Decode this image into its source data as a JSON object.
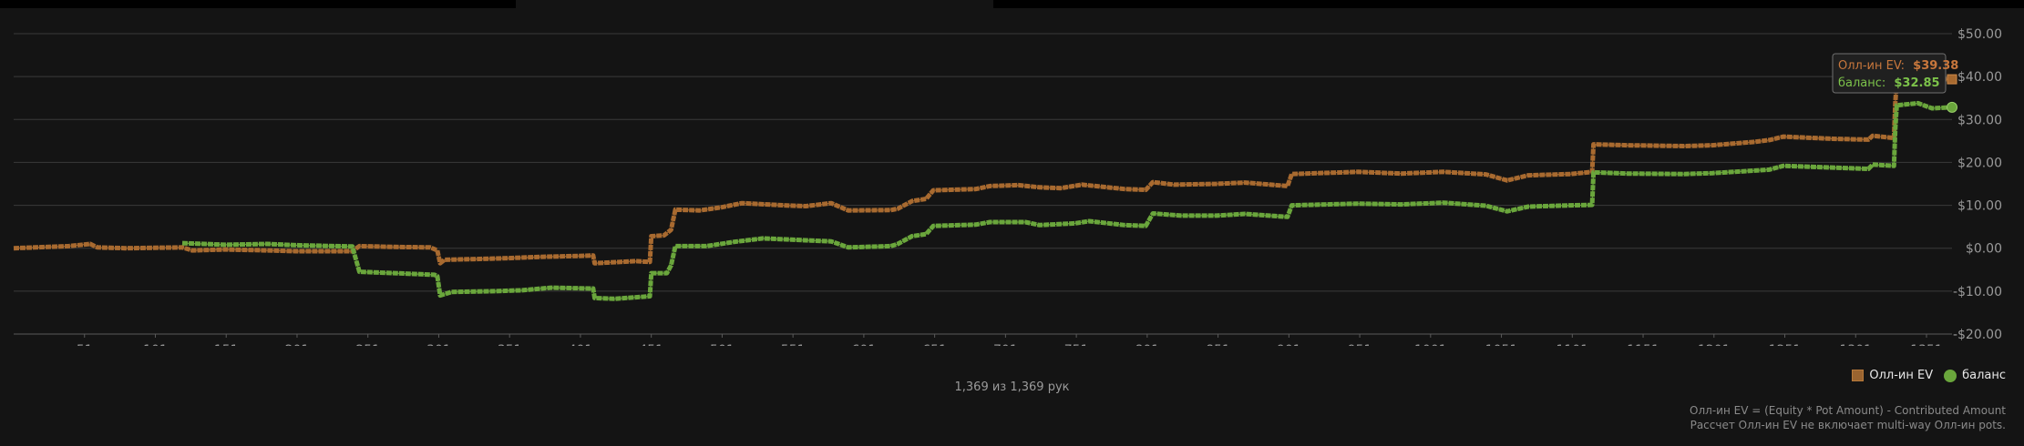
{
  "chart_data": {
    "type": "line",
    "xlabel": "",
    "ylabel": "",
    "xlim": [
      1,
      1369
    ],
    "ylim": [
      -20,
      50
    ],
    "y_ticks": [
      "$50.00",
      "$40.00",
      "$30.00",
      "$20.00",
      "$10.00",
      "$0.00",
      "-$10.00",
      "-$20.00"
    ],
    "y_tick_values": [
      50,
      40,
      30,
      20,
      10,
      0,
      -10,
      -20
    ],
    "x_ticks": [
      "51",
      "101",
      "151",
      "201",
      "251",
      "301",
      "351",
      "401",
      "451",
      "501",
      "551",
      "601",
      "651",
      "701",
      "751",
      "801",
      "851",
      "901",
      "951",
      "1001",
      "1051",
      "1101",
      "1151",
      "1201",
      "1251",
      "1301",
      "1351"
    ],
    "x_tick_values": [
      51,
      101,
      151,
      201,
      251,
      301,
      351,
      401,
      451,
      501,
      551,
      601,
      651,
      701,
      751,
      801,
      851,
      901,
      951,
      1001,
      1051,
      1101,
      1151,
      1201,
      1251,
      1301,
      1351
    ],
    "grid": true,
    "legend_position": "bottom-right",
    "series": [
      {
        "name": "Олл-ин EV",
        "color": "#a86a30",
        "points": [
          [
            1,
            0
          ],
          [
            40,
            0.5
          ],
          [
            55,
            1
          ],
          [
            60,
            0.2
          ],
          [
            80,
            0
          ],
          [
            120,
            0.2
          ],
          [
            127,
            -0.5
          ],
          [
            150,
            -0.3
          ],
          [
            180,
            -0.5
          ],
          [
            200,
            -0.7
          ],
          [
            240,
            -0.7
          ],
          [
            245,
            0.5
          ],
          [
            270,
            0.3
          ],
          [
            295,
            0.2
          ],
          [
            300,
            -0.5
          ],
          [
            302,
            -3.5
          ],
          [
            305,
            -2.7
          ],
          [
            330,
            -2.5
          ],
          [
            350,
            -2.3
          ],
          [
            375,
            -2
          ],
          [
            400,
            -1.8
          ],
          [
            410,
            -1.7
          ],
          [
            411,
            -3.5
          ],
          [
            440,
            -3
          ],
          [
            450,
            -3.2
          ],
          [
            451,
            2.8
          ],
          [
            460,
            3.0
          ],
          [
            465,
            4.3
          ],
          [
            468,
            9
          ],
          [
            485,
            8.8
          ],
          [
            500,
            9.5
          ],
          [
            515,
            10.5
          ],
          [
            545,
            10
          ],
          [
            560,
            9.8
          ],
          [
            578,
            10.5
          ],
          [
            590,
            8.8
          ],
          [
            620,
            8.9
          ],
          [
            625,
            9.2
          ],
          [
            635,
            11
          ],
          [
            645,
            11.5
          ],
          [
            650,
            13.5
          ],
          [
            680,
            13.8
          ],
          [
            690,
            14.5
          ],
          [
            710,
            14.7
          ],
          [
            725,
            14.2
          ],
          [
            740,
            14.0
          ],
          [
            755,
            14.8
          ],
          [
            785,
            13.8
          ],
          [
            800,
            13.6
          ],
          [
            805,
            15.4
          ],
          [
            820,
            14.8
          ],
          [
            850,
            15
          ],
          [
            870,
            15.3
          ],
          [
            900,
            14.5
          ],
          [
            903,
            17.3
          ],
          [
            950,
            17.8
          ],
          [
            980,
            17.4
          ],
          [
            1010,
            17.8
          ],
          [
            1040,
            17.2
          ],
          [
            1055,
            15.8
          ],
          [
            1070,
            17
          ],
          [
            1100,
            17.3
          ],
          [
            1115,
            17.8
          ],
          [
            1116,
            24.2
          ],
          [
            1140,
            24.0
          ],
          [
            1180,
            23.8
          ],
          [
            1200,
            24.0
          ],
          [
            1230,
            24.8
          ],
          [
            1240,
            25.2
          ],
          [
            1250,
            26
          ],
          [
            1285,
            25.5
          ],
          [
            1310,
            25.3
          ],
          [
            1313,
            26.2
          ],
          [
            1328,
            25.7
          ],
          [
            1329,
            34
          ],
          [
            1330,
            39
          ],
          [
            1345,
            39.3
          ],
          [
            1360,
            39.4
          ],
          [
            1369,
            39.38
          ]
        ]
      },
      {
        "name": "баланс",
        "color": "#6aa63c",
        "points": [
          [
            120,
            1.2
          ],
          [
            150,
            0.8
          ],
          [
            180,
            1.0
          ],
          [
            200,
            0.7
          ],
          [
            240,
            0.4
          ],
          [
            245,
            -5.5
          ],
          [
            270,
            -5.8
          ],
          [
            298,
            -6.2
          ],
          [
            300,
            -6.5
          ],
          [
            302,
            -11
          ],
          [
            310,
            -10.2
          ],
          [
            340,
            -10
          ],
          [
            360,
            -9.8
          ],
          [
            380,
            -9.2
          ],
          [
            410,
            -9.4
          ],
          [
            411,
            -11.6
          ],
          [
            425,
            -11.8
          ],
          [
            450,
            -11.2
          ],
          [
            451,
            -5.8
          ],
          [
            462,
            -5.8
          ],
          [
            465,
            -4
          ],
          [
            468,
            0.5
          ],
          [
            490,
            0.5
          ],
          [
            510,
            1.5
          ],
          [
            530,
            2.3
          ],
          [
            550,
            2
          ],
          [
            578,
            1.6
          ],
          [
            590,
            0.2
          ],
          [
            620,
            0.5
          ],
          [
            625,
            1
          ],
          [
            635,
            2.8
          ],
          [
            645,
            3.3
          ],
          [
            650,
            5.2
          ],
          [
            680,
            5.5
          ],
          [
            690,
            6.1
          ],
          [
            715,
            6.1
          ],
          [
            725,
            5.4
          ],
          [
            750,
            5.8
          ],
          [
            760,
            6.3
          ],
          [
            785,
            5.4
          ],
          [
            800,
            5.2
          ],
          [
            805,
            8.1
          ],
          [
            825,
            7.6
          ],
          [
            850,
            7.6
          ],
          [
            870,
            8
          ],
          [
            900,
            7.3
          ],
          [
            903,
            10
          ],
          [
            950,
            10.4
          ],
          [
            980,
            10.2
          ],
          [
            1010,
            10.6
          ],
          [
            1040,
            9.9
          ],
          [
            1055,
            8.6
          ],
          [
            1070,
            9.7
          ],
          [
            1100,
            10
          ],
          [
            1115,
            10.1
          ],
          [
            1116,
            17.7
          ],
          [
            1140,
            17.4
          ],
          [
            1180,
            17.3
          ],
          [
            1200,
            17.5
          ],
          [
            1230,
            18.1
          ],
          [
            1240,
            18.3
          ],
          [
            1250,
            19.2
          ],
          [
            1285,
            18.8
          ],
          [
            1310,
            18.5
          ],
          [
            1313,
            19.5
          ],
          [
            1328,
            19.2
          ],
          [
            1329,
            28
          ],
          [
            1330,
            33.3
          ],
          [
            1345,
            33.8
          ],
          [
            1355,
            32.6
          ],
          [
            1369,
            32.85
          ]
        ]
      }
    ],
    "tooltip": {
      "ev_label": "Олл-ин EV:",
      "ev_value": "$39.38",
      "bal_label": "баланс:",
      "bal_value": "$32.85"
    }
  },
  "legend": [
    {
      "label": "Олл-ин EV",
      "icon": "square-marker-icon",
      "color": "#a86a30"
    },
    {
      "label": "баланс",
      "icon": "circle-marker-icon",
      "color": "#6aa63c"
    }
  ],
  "hands_count": "1,369 из 1,369 рук",
  "footnote": {
    "line1": "Олл-ин EV = (Equity * Pot Amount) - Contributed Amount",
    "line2": "Рассчет Олл-ин EV не включает multi-way Олл-ин pots."
  }
}
